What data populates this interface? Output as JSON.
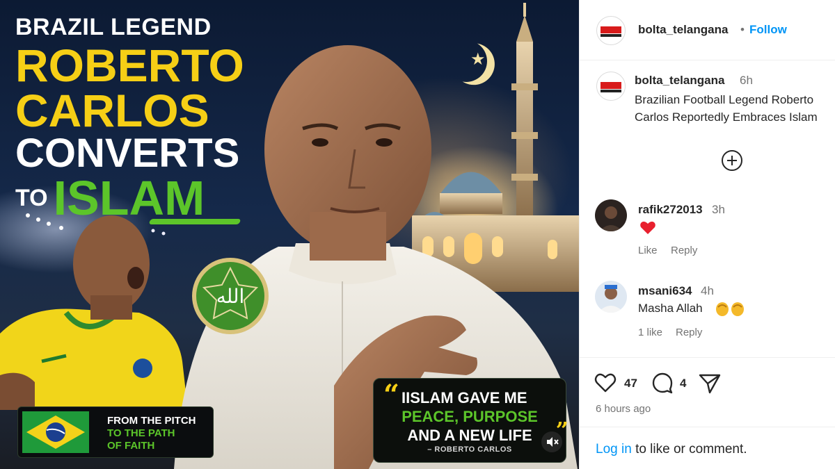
{
  "media": {
    "headline": {
      "line1": "BRAZIL LEGEND",
      "name_first": "ROBERTO",
      "name_last": "CARLOS",
      "converts": "CONVERTS",
      "to": "TO",
      "islam": "ISLAM"
    },
    "badge_text": "الله",
    "flag_caption": {
      "line1": "FROM THE PITCH",
      "line2": "TO THE PATH",
      "line3": "OF FAITH"
    },
    "quote": {
      "line1": "IISLAM GAVE ME",
      "line2": "PEACE, PURPOSE",
      "line3": "AND A NEW LIFE",
      "author": "– ROBERTO CARLOS"
    },
    "mute_icon": "speaker-muted-icon",
    "colors": {
      "yellow": "#f6cf16",
      "green": "#5cc52a",
      "sky_top": "#0c1a33"
    }
  },
  "post": {
    "header": {
      "username": "bolta_telangana",
      "dot": "•",
      "follow_label": "Follow"
    },
    "caption": {
      "username": "bolta_telangana",
      "time": "6h",
      "text": "Brazilian Football Legend Roberto Carlos Reportedly Embraces Islam"
    },
    "load_more_icon": "plus-circle-icon",
    "comments": [
      {
        "username": "rafik272013",
        "time": "3h",
        "text": "",
        "emoji": "red-heart-icon",
        "likes": "",
        "reply_label": "Reply",
        "like_label": "Like"
      },
      {
        "username": "msani634",
        "time": "4h",
        "text": "Masha Allah",
        "emoji": "clapping-hands-icon",
        "likes": "1 like",
        "reply_label": "Reply"
      }
    ],
    "actions": {
      "like_count": "47",
      "comment_count": "4",
      "like_icon": "heart-icon",
      "comment_icon": "comment-icon",
      "share_icon": "share-icon"
    },
    "posted_time": "6 hours ago",
    "login_prompt": {
      "link": "Log in",
      "rest": "to like or comment."
    },
    "colors": {
      "link_blue": "#0095f6",
      "text": "#262626",
      "muted": "#737373"
    }
  }
}
